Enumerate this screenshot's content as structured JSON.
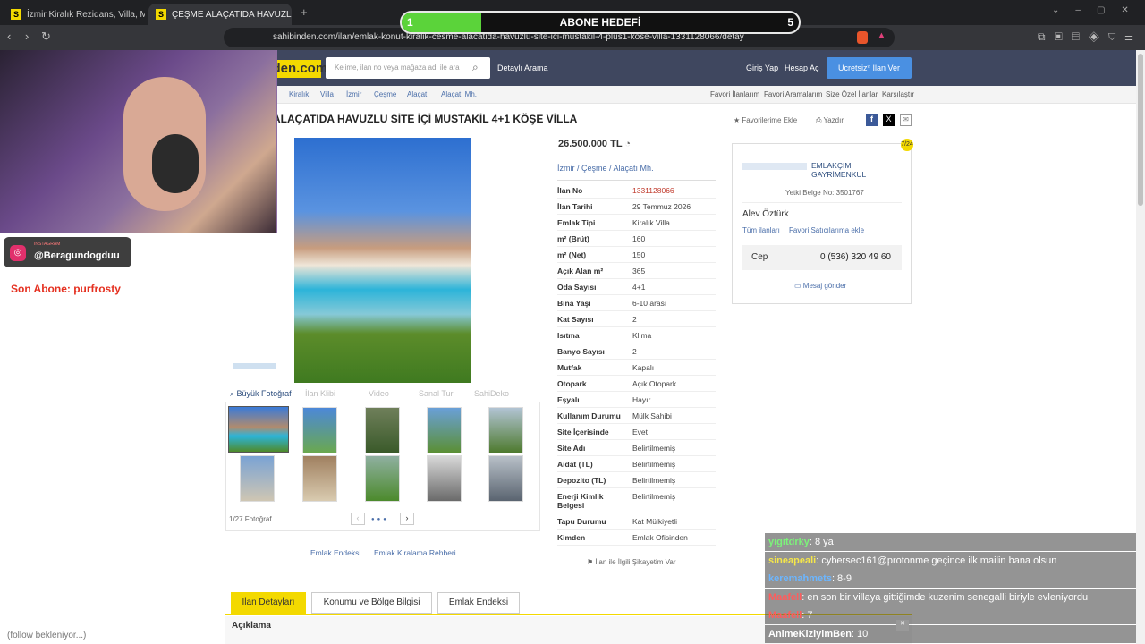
{
  "browser": {
    "tabs": [
      {
        "label": "İzmir Kiralık Rezidans, Villa, Müstakil"
      },
      {
        "label": "ÇEŞME ALAÇATIDA HAVUZLU Sİ"
      }
    ],
    "url": "sahibinden.com/ilan/emlak-konut-kiralik-cesme-alacatida-havuzlu-site-ici-mustakil-4-plus1-kose-villa-1331128066/detay"
  },
  "goal": {
    "label": "ABONE HEDEFİ",
    "current": "1",
    "target": "5",
    "progress": 0.2
  },
  "site": {
    "logo": "sahibinden.com",
    "search_placeholder": "Kelime, ilan no veya mağaza adı ile ara",
    "detailed_search": "Detaylı Arama",
    "login": "Giriş Yap",
    "register": "Hesap Aç",
    "post_ad": "Ücretsiz* İlan Ver"
  },
  "breadcrumbs": [
    "Kiralık",
    "Villa",
    "İzmir",
    "Çeşme",
    "Alaçatı",
    "Alaçatı Mh."
  ],
  "quick_links": [
    "Favori İlanlarım",
    "Favori Aramalarım",
    "Size Özel İlanlar",
    "Karşılaştır"
  ],
  "listing": {
    "title": "ALAÇATIDA HAVUZLU SİTE İÇİ MUSTAKİL 4+1 KÖŞE VİLLA",
    "add_favorite": "Favorilerime Ekle",
    "print": "Yazdır",
    "price": "26.500.000 TL",
    "location": [
      "İzmir",
      "Çeşme",
      "Alaçatı Mh."
    ],
    "photo_tools": [
      "Büyük Fotoğraf",
      "İlan Klibi",
      "Video",
      "Sanal Tur",
      "SahiDeko"
    ],
    "photo_counter": "1/27 Fotoğraf",
    "details": [
      {
        "k": "İlan No",
        "v": "1331128066"
      },
      {
        "k": "İlan Tarihi",
        "v": "29 Temmuz 2026"
      },
      {
        "k": "Emlak Tipi",
        "v": "Kiralık Villa"
      },
      {
        "k": "m² (Brüt)",
        "v": "160"
      },
      {
        "k": "m² (Net)",
        "v": "150"
      },
      {
        "k": "Açık Alan m²",
        "v": "365"
      },
      {
        "k": "Oda Sayısı",
        "v": "4+1"
      },
      {
        "k": "Bina Yaşı",
        "v": "6-10 arası"
      },
      {
        "k": "Kat Sayısı",
        "v": "2"
      },
      {
        "k": "Isıtma",
        "v": "Klima"
      },
      {
        "k": "Banyo Sayısı",
        "v": "2"
      },
      {
        "k": "Mutfak",
        "v": "Kapalı"
      },
      {
        "k": "Otopark",
        "v": "Açık Otopark"
      },
      {
        "k": "Eşyalı",
        "v": "Hayır"
      },
      {
        "k": "Kullanım Durumu",
        "v": "Mülk Sahibi"
      },
      {
        "k": "Site İçerisinde",
        "v": "Evet"
      },
      {
        "k": "Site Adı",
        "v": "Belirtilmemiş"
      },
      {
        "k": "Aidat (TL)",
        "v": "Belirtilmemiş"
      },
      {
        "k": "Depozito (TL)",
        "v": "Belirtilmemiş"
      },
      {
        "k": "Enerji Kimlik Belgesi",
        "v": "Belirtilmemiş"
      },
      {
        "k": "Tapu Durumu",
        "v": "Kat Mülkiyetli"
      },
      {
        "k": "Kimden",
        "v": "Emlak Ofisinden"
      }
    ],
    "complaint": "İlan ile İlgili Şikayetim Var",
    "links": [
      "Emlak Endeksi",
      "Emlak Kiralama Rehberi"
    ]
  },
  "seller": {
    "office": "EMLAKÇIM GAYRİMENKUL",
    "cert": "Yetki Belge No: 3501767",
    "agent": "Alev Öztürk",
    "all_ads": "Tüm ilanları",
    "fav_seller": "Favori Satıcılarıma ekle",
    "phone_label": "Cep",
    "phone": "0 (536) 320 49 60",
    "message": "Mesaj gönder"
  },
  "bottom_tabs": [
    "İlan Detayları",
    "Konumu ve Bölge Bilgisi",
    "Emlak Endeksi"
  ],
  "section_title": "Açıklama",
  "stream": {
    "instagram_label": "INSTAGRAM",
    "instagram_handle": "@Beragundogduu",
    "last_sub": "Son Abone: purfrosty",
    "follow_text": "(follow bekleniyor...)",
    "chat": [
      {
        "user": "yigitdrky",
        "msg": ": 8 ya"
      },
      {
        "user": "sineapeali",
        "msg": ": cybersec161@protonme geçince ilk mailin bana olsun"
      },
      {
        "user": "keremahmets",
        "msg": ": 8-9"
      },
      {
        "user": "Maafell",
        "msg": ": en son bir villaya gittiğimde kuzenim senegalli biriyle evleniyordu"
      },
      {
        "user": "Maafell",
        "msg": ": 7"
      },
      {
        "user": "AnimeKiziyimBen",
        "msg": ": 10"
      }
    ]
  }
}
